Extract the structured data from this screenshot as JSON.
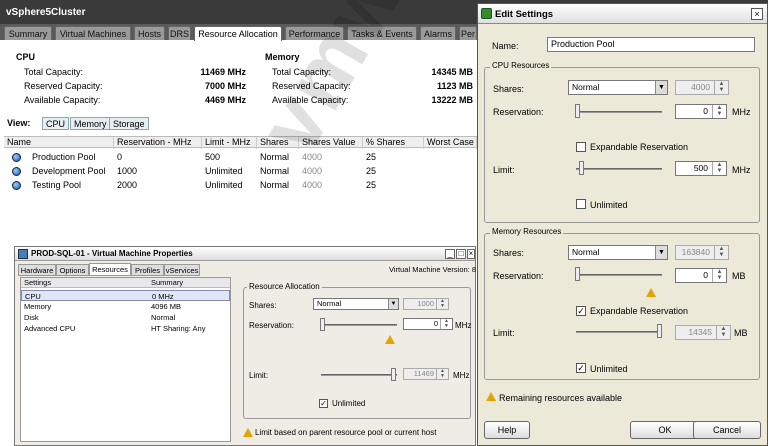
{
  "main": {
    "title": "vSphere5Cluster",
    "tabs": [
      "Summary",
      "Virtual Machines",
      "Hosts",
      "DRS",
      "Resource Allocation",
      "Performance",
      "Tasks & Events",
      "Alarms",
      "Per"
    ],
    "cpu": {
      "heading": "CPU",
      "total_label": "Total Capacity:",
      "total": "11469 MHz",
      "reserved_label": "Reserved Capacity:",
      "reserved": "7000 MHz",
      "available_label": "Available Capacity:",
      "available": "4469 MHz"
    },
    "memory": {
      "heading": "Memory",
      "total_label": "Total Capacity:",
      "total": "14345 MB",
      "reserved_label": "Reserved Capacity:",
      "reserved": "1123 MB",
      "available_label": "Available Capacity:",
      "available": "13222 MB"
    },
    "view_label": "View:",
    "view_buttons": [
      "CPU",
      "Memory",
      "Storage"
    ],
    "columns": [
      "Name",
      "Reservation - MHz",
      "Limit - MHz",
      "Shares",
      "Shares Value",
      "% Shares",
      "Worst Case"
    ],
    "rows": [
      {
        "name": "Production Pool",
        "reservation": "0",
        "limit": "500",
        "shares": "Normal",
        "shares_value": "4000",
        "pct": "25"
      },
      {
        "name": "Development Pool",
        "reservation": "1000",
        "limit": "Unlimited",
        "shares": "Normal",
        "shares_value": "4000",
        "pct": "25"
      },
      {
        "name": "Testing Pool",
        "reservation": "2000",
        "limit": "Unlimited",
        "shares": "Normal",
        "shares_value": "4000",
        "pct": "25"
      }
    ]
  },
  "vm_props": {
    "title": "PROD-SQL-01 - Virtual Machine Properties",
    "tabs": [
      "Hardware",
      "Options",
      "Resources",
      "Profiles",
      "vServices"
    ],
    "version": "Virtual Machine Version: 8",
    "list_headers": [
      "Settings",
      "Summary"
    ],
    "list_rows": [
      {
        "setting": "CPU",
        "summary": "0 MHz"
      },
      {
        "setting": "Memory",
        "summary": "4096 MB"
      },
      {
        "setting": "Disk",
        "summary": "Normal"
      },
      {
        "setting": "Advanced CPU",
        "summary": "HT Sharing: Any"
      }
    ],
    "group_label": "Resource Allocation",
    "shares_label": "Shares:",
    "shares_value": "Normal",
    "shares_num": "1000",
    "reservation_label": "Reservation:",
    "reservation": "0",
    "limit_label": "Limit:",
    "limit": "11469",
    "unit": "MHz",
    "unlimited_label": "Unlimited",
    "note": "Limit based on parent resource pool or current host"
  },
  "edit": {
    "title": "Edit Settings",
    "name_label": "Name:",
    "name_value": "Production Pool",
    "cpu_group": "CPU Resources",
    "shares_label": "Shares:",
    "cpu_shares": "Normal",
    "cpu_shares_num": "4000",
    "reservation_label": "Reservation:",
    "cpu_reservation": "0",
    "mhz": "MHz",
    "expandable_label": "Expandable Reservation",
    "limit_label": "Limit:",
    "cpu_limit": "500",
    "unlimited_label": "Unlimited",
    "mem_group": "Memory Resources",
    "mem_shares": "Normal",
    "mem_shares_num": "163840",
    "mem_reservation": "0",
    "mb": "MB",
    "mem_limit": "14345",
    "remaining": "Remaining resources available",
    "help": "Help",
    "ok": "OK",
    "cancel": "Cancel"
  },
  "watermark": "vmware"
}
